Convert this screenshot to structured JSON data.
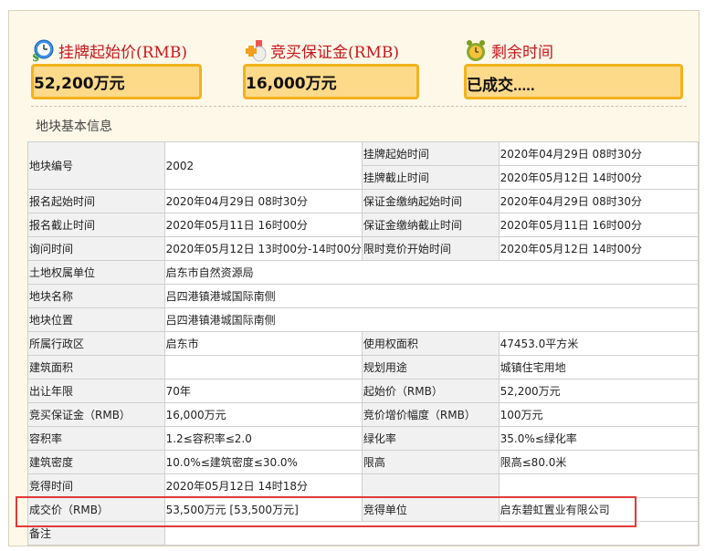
{
  "stats": [
    {
      "label": "挂牌起始价(RMB)",
      "value": "52,200万元",
      "icon": "clock-money-icon"
    },
    {
      "label": "竞买保证金(RMB)",
      "value": "16,000万元",
      "icon": "money-bag-icon"
    },
    {
      "label": "剩余时间",
      "value": "已成交.....",
      "icon": "alarm-clock-icon"
    }
  ],
  "section_title": "地块基本信息",
  "table": {
    "first": {
      "label": "地块编号",
      "value": "2002",
      "sub": [
        [
          "挂牌起始时间",
          "2020年04月29日 08时30分"
        ],
        [
          "挂牌截止时间",
          "2020年05月12日 14时00分"
        ]
      ]
    },
    "rows": [
      [
        "报名起始时间",
        "2020年04月29日 08时30分",
        "保证金缴纳起始时间",
        "2020年04月29日 08时30分"
      ],
      [
        "报名截止时间",
        "2020年05月11日 16时00分",
        "保证金缴纳截止时间",
        "2020年05月11日 16时00分"
      ],
      [
        "询问时间",
        "2020年05月12日 13时00分-14时00分",
        "限时竞价开始时间",
        "2020年05月12日 14时00分"
      ],
      [
        "土地权属单位",
        "启东市自然资源局"
      ],
      [
        "地块名称",
        "吕四港镇港城国际南侧"
      ],
      [
        "地块位置",
        "吕四港镇港城国际南侧"
      ],
      [
        "所属行政区",
        "启东市",
        "使用权面积",
        "47453.0平方米"
      ],
      [
        "建筑面积",
        "",
        "规划用途",
        "城镇住宅用地"
      ],
      [
        "出让年限",
        "70年",
        "起始价（RMB）",
        "52,200万元"
      ],
      [
        "竞买保证金（RMB）",
        "16,000万元",
        "竞价增价幅度（RMB）",
        "100万元"
      ],
      [
        "容积率",
        "1.2≤容积率≤2.0",
        "绿化率",
        "35.0%≤绿化率"
      ],
      [
        "建筑密度",
        "10.0%≤建筑密度≤30.0%",
        "限高",
        "限高≤80.0米"
      ],
      [
        "竞得时间",
        "2020年05月12日 14时18分",
        "",
        ""
      ],
      [
        "成交价（RMB）",
        "53,500万元 [53,500万元]",
        "竞得单位",
        "启东碧虹置业有限公司"
      ],
      [
        "备注",
        ""
      ]
    ]
  },
  "colors": {
    "accent_red": "#c8161d",
    "box_fill": "#fdd98a",
    "box_border": "#f2b21c",
    "highlight": "#e03a3a"
  }
}
